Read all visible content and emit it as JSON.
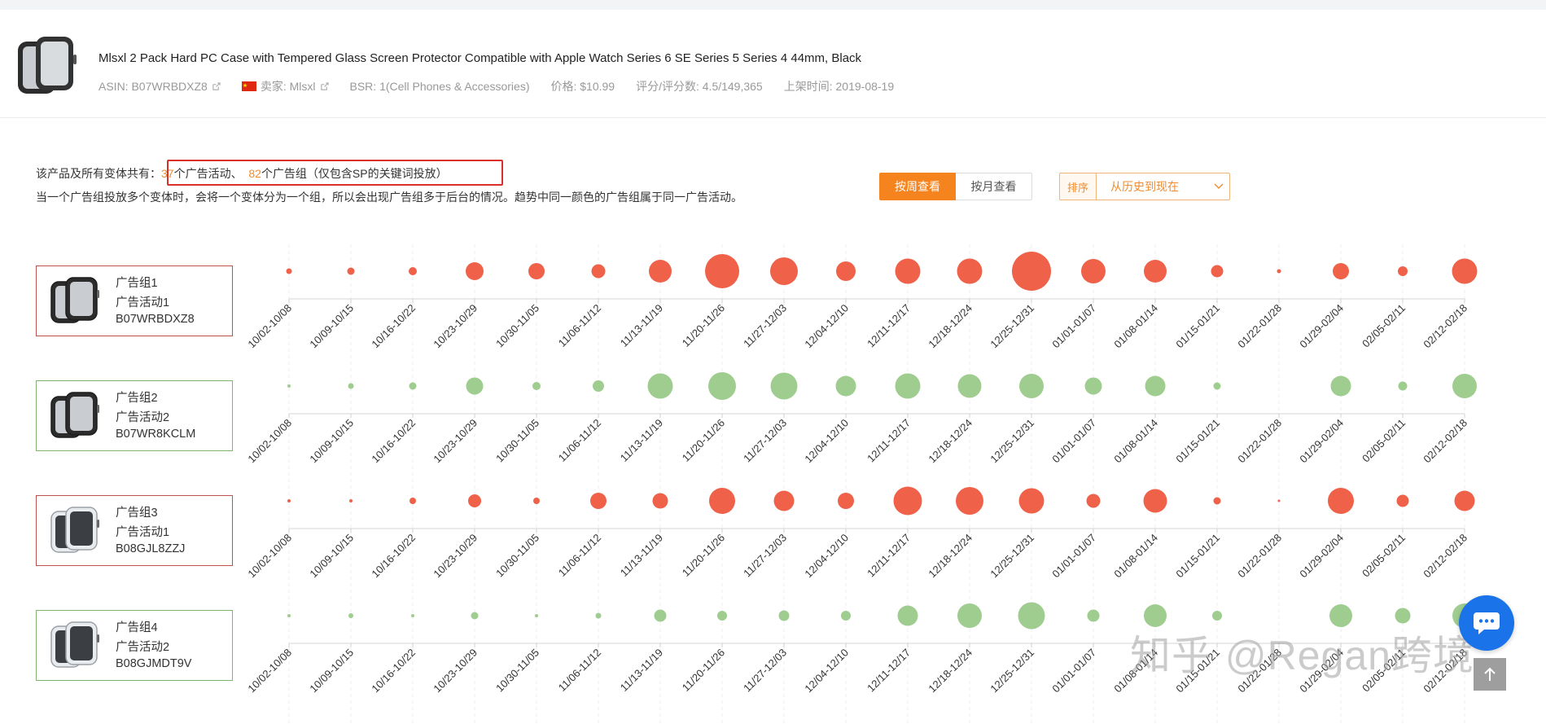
{
  "product": {
    "title": "Mlsxl 2 Pack Hard PC Case with Tempered Glass Screen Protector Compatible with Apple Watch Series 6 SE Series 5 Series 4 44mm, Black",
    "asin": "ASIN: B07WRBDXZ8",
    "seller": "卖家: Mlsxl",
    "bsr": "BSR: 1(Cell Phones & Accessories)",
    "price": "价格: $10.99",
    "rating": "评分/评分数: 4.5/149,365",
    "listed": "上架时间: 2019-08-19"
  },
  "summary": {
    "prefix": "该产品及所有变体共有：",
    "campaign_count": "37",
    "campaign_text": "个广告活动、",
    "group_count": "82",
    "group_text": "个广告组（仅包含SP的关键词投放）",
    "note": "当一个广告组投放多个变体时，会将一个变体分为一个组，所以会出现广告组多于后台的情况。趋势中同一颜色的广告组属于同一广告活动。"
  },
  "controls": {
    "week_label": "按周查看",
    "month_label": "按月查看",
    "sort_label": "排序",
    "sort_value": "从历史到现在"
  },
  "colors": {
    "red": "#f0614a",
    "green": "#9fcd8f",
    "accent": "#f5841f",
    "highlight": "#d9302c"
  },
  "icons": {
    "chat": "chat-bubble-icon",
    "top": "arrow-up-icon",
    "external": "external-link-icon",
    "flag": "china-flag-icon"
  },
  "groups": [
    {
      "name": "广告组1",
      "campaign": "广告活动1",
      "asin": "B07WRBDXZ8",
      "color": "red",
      "watch": "black"
    },
    {
      "name": "广告组2",
      "campaign": "广告活动2",
      "asin": "B07WR8KCLM",
      "color": "green",
      "watch": "black"
    },
    {
      "name": "广告组3",
      "campaign": "广告活动1",
      "asin": "B08GJL8ZZJ",
      "color": "red",
      "watch": "clear"
    },
    {
      "name": "广告组4",
      "campaign": "广告活动2",
      "asin": "B08GJMDT9V",
      "color": "green",
      "watch": "clear"
    }
  ],
  "chart_data": {
    "type": "scatter",
    "categories": [
      "10/02-10/08",
      "10/09-10/15",
      "10/16-10/22",
      "10/23-10/29",
      "10/30-11/05",
      "11/06-11/12",
      "11/13-11/19",
      "11/20-11/26",
      "11/27-12/03",
      "12/04-12/10",
      "12/11-12/17",
      "12/18-12/24",
      "12/25-12/31",
      "01/01-01/07",
      "01/08-01/14",
      "01/15-01/21",
      "01/22-01/28",
      "01/29-02/04",
      "02/05-02/11",
      "02/12-02/18"
    ],
    "series": [
      {
        "name": "广告组1",
        "values": [
          3.5,
          4.5,
          5,
          11,
          10,
          8.5,
          14,
          21,
          17,
          12,
          15.5,
          15.5,
          24,
          15,
          14,
          7.5,
          2.5,
          10,
          6,
          15.5
        ]
      },
      {
        "name": "广告组2",
        "values": [
          2,
          3.5,
          4.5,
          10.5,
          5,
          7,
          15.5,
          17,
          16.5,
          12.5,
          15.5,
          14.5,
          15,
          10.5,
          12.5,
          4.5,
          0,
          12.5,
          5.5,
          15
        ]
      },
      {
        "name": "广告组3",
        "values": [
          2,
          2,
          4,
          8,
          4,
          10,
          9.5,
          16,
          12.5,
          10,
          17.5,
          17,
          15.5,
          8.5,
          14.5,
          4.5,
          1.5,
          16,
          7.5,
          12.5
        ]
      },
      {
        "name": "广告组4",
        "values": [
          2,
          3,
          2,
          4.5,
          2,
          3.5,
          7.5,
          6,
          6.5,
          6,
          12.5,
          15,
          16.5,
          7.5,
          14,
          6,
          0,
          14,
          9.5,
          15
        ]
      }
    ]
  },
  "watermark": "知乎 @Regan跨境"
}
